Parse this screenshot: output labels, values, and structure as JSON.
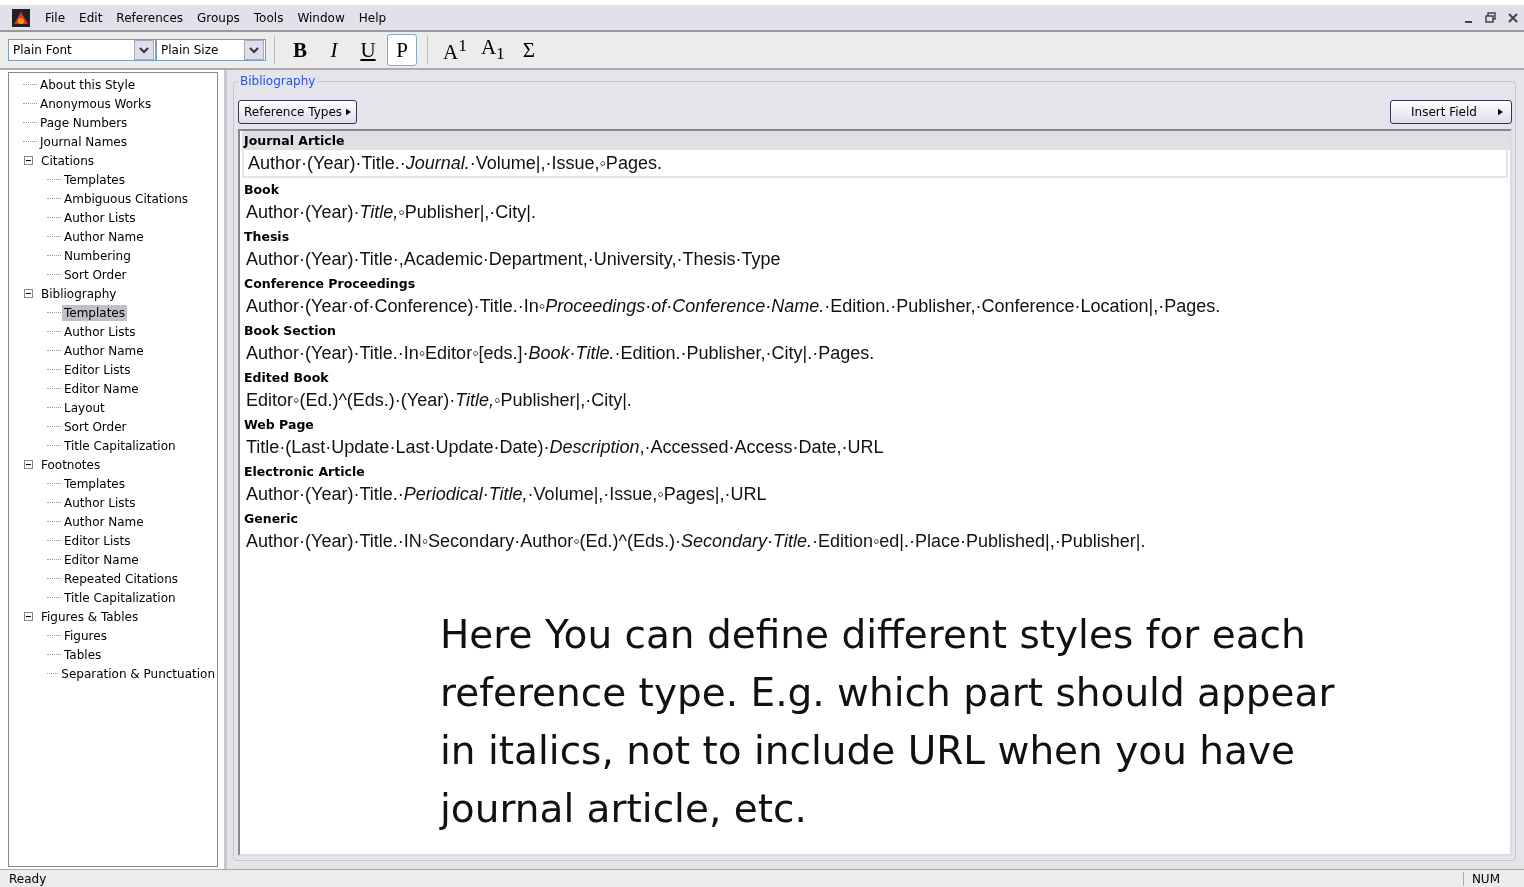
{
  "menu": [
    "File",
    "Edit",
    "References",
    "Groups",
    "Tools",
    "Window",
    "Help"
  ],
  "toolbar": {
    "font": "Plain Font",
    "size": "Plain Size",
    "buttons": [
      {
        "label": "B",
        "kind": "bold",
        "selected": false
      },
      {
        "label": "I",
        "kind": "italic",
        "selected": false
      },
      {
        "label": "U",
        "kind": "underline",
        "selected": false
      },
      {
        "label": "P",
        "kind": "plain",
        "selected": true
      },
      {
        "label": "A$^{1}$",
        "kind": "super",
        "selected": false
      },
      {
        "label": "A$_{1}$",
        "kind": "sub",
        "selected": false
      },
      {
        "label": "Σ",
        "kind": "symbol",
        "selected": false
      }
    ]
  },
  "tree": [
    {
      "label": "About this Style",
      "selected": false
    },
    {
      "label": "Anonymous Works",
      "selected": false
    },
    {
      "label": "Page Numbers",
      "selected": false
    },
    {
      "label": "Journal Names",
      "selected": false
    },
    {
      "label": "Citations",
      "selected": false,
      "expanded": true,
      "children": [
        {
          "label": "Templates",
          "selected": false
        },
        {
          "label": "Ambiguous Citations",
          "selected": false
        },
        {
          "label": "Author Lists",
          "selected": false
        },
        {
          "label": "Author Name",
          "selected": false
        },
        {
          "label": "Numbering",
          "selected": false
        },
        {
          "label": "Sort Order",
          "selected": false
        }
      ]
    },
    {
      "label": "Bibliography",
      "selected": false,
      "expanded": true,
      "children": [
        {
          "label": "Templates",
          "selected": true
        },
        {
          "label": "Author Lists",
          "selected": false
        },
        {
          "label": "Author Name",
          "selected": false
        },
        {
          "label": "Editor Lists",
          "selected": false
        },
        {
          "label": "Editor Name",
          "selected": false
        },
        {
          "label": "Layout",
          "selected": false
        },
        {
          "label": "Sort Order",
          "selected": false
        },
        {
          "label": "Title Capitalization",
          "selected": false
        }
      ]
    },
    {
      "label": "Footnotes",
      "selected": false,
      "expanded": true,
      "children": [
        {
          "label": "Templates",
          "selected": false
        },
        {
          "label": "Author Lists",
          "selected": false
        },
        {
          "label": "Author Name",
          "selected": false
        },
        {
          "label": "Editor Lists",
          "selected": false
        },
        {
          "label": "Editor Name",
          "selected": false
        },
        {
          "label": "Repeated Citations",
          "selected": false
        },
        {
          "label": "Title Capitalization",
          "selected": false
        }
      ]
    },
    {
      "label": "Figures & Tables",
      "selected": false,
      "expanded": true,
      "children": [
        {
          "label": "Figures",
          "selected": false
        },
        {
          "label": "Tables",
          "selected": false
        },
        {
          "label": "Separation & Punctuation",
          "selected": false
        }
      ]
    }
  ],
  "panel": {
    "title": "Bibliography",
    "reference_types_button": "Reference Types",
    "insert_field_button": "Insert Field"
  },
  "templates": [
    {
      "type": "Journal Article",
      "selected": true,
      "template": "Author·(Year)·Title.·*Journal.*·Volume|,·Issue,◦Pages."
    },
    {
      "type": "Book",
      "selected": false,
      "template": "Author·(Year)·*Title,*◦Publisher|,·City|."
    },
    {
      "type": "Thesis",
      "selected": false,
      "template": "Author·(Year)·Title·,Academic·Department,·University,·Thesis·Type"
    },
    {
      "type": "Conference Proceedings",
      "selected": false,
      "template": "Author·(Year·of·Conference)·Title.·In◦*Proceedings·of·Conference·Name.*·Edition.·Publisher,·Conference·Location|,·Pages."
    },
    {
      "type": "Book Section",
      "selected": false,
      "template": "Author·(Year)·Title.·In◦Editor◦[eds.]·*Book·Title.*·Edition.·Publisher,·City|.·Pages."
    },
    {
      "type": "Edited Book",
      "selected": false,
      "template": "Editor◦(Ed.)^(Eds.)·(Year)·*Title,*◦Publisher|,·City|."
    },
    {
      "type": "Web Page",
      "selected": false,
      "template": "Title·(Last·Update·Last·Update·Date)·*Description*,·Accessed·Access·Date,·URL"
    },
    {
      "type": "Electronic Article",
      "selected": false,
      "template": "Author·(Year)·Title.·*Periodical·Title,*·Volume|,·Issue,◦Pages|,·URL"
    },
    {
      "type": "Generic",
      "selected": false,
      "template": "Author·(Year)·Title.·IN◦Secondary·Author◦(Ed.)^(Eds.)·*Secondary·Title.*·Edition◦ed|.·Place·Published|,·Publisher|."
    }
  ],
  "annotation": "Here You can define different styles for each reference type. E.g. which part should appear in italics, not to include URL when you have journal article, etc.",
  "status_bar": {
    "message": "Ready",
    "num": "NUM"
  }
}
